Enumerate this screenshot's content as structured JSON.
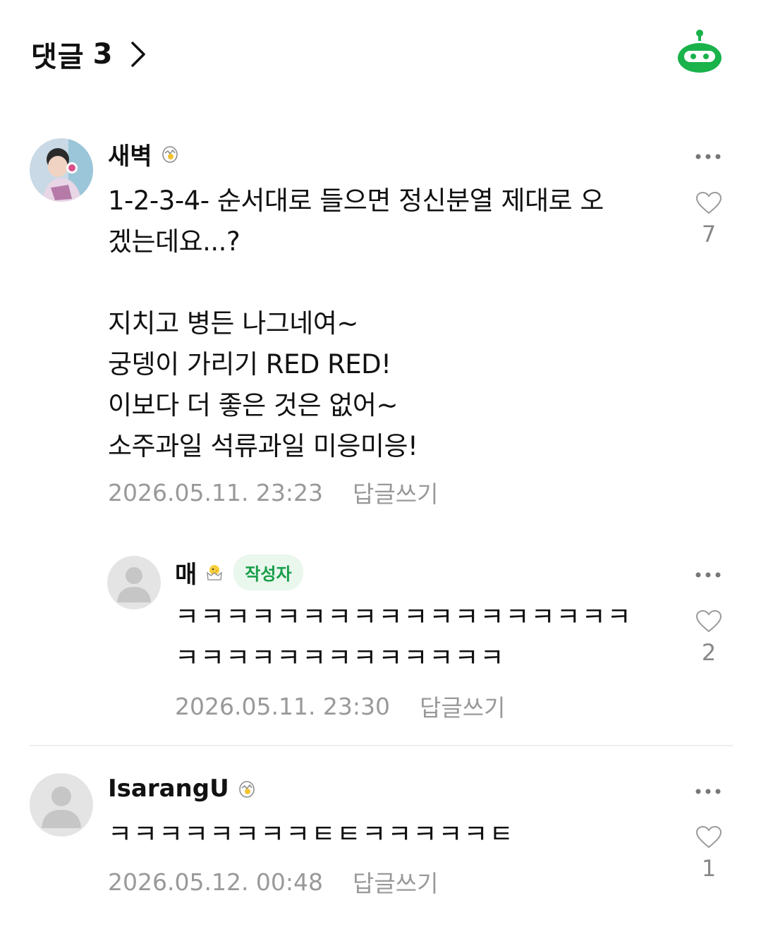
{
  "header": {
    "title": "댓글",
    "count": "3"
  },
  "colors": {
    "brand_green": "#19b24b",
    "meta_gray": "#999999",
    "badge_bg": "#e9f7ed",
    "badge_text": "#1a9e4a"
  },
  "comments": [
    {
      "author": "새벽",
      "avatar": "profile-photo",
      "level_icon": "egg-hatching-icon",
      "body": "1-2-3-4- 순서대로 들으면 정신분열 제대로 오\n겠는데요...?\n\n지치고 병든 나그네여~\n궁뎅이 가리기 RED RED!\n이보다 더 좋은 것은 없어~\n소주과일 석류과일 미응미응!",
      "date": "2026.05.11. 23:23",
      "reply_label": "답글쓰기",
      "likes": "7",
      "replies": [
        {
          "author": "매",
          "avatar": "default-avatar",
          "level_icon": "chick-icon",
          "badge": "작성자",
          "body": "ㅋㅋㅋㅋㅋㅋㅋㅋㅋㅋㅋㅋㅋㅋㅋㅋㅋㅋ\nㅋㅋㅋㅋㅋㅋㅋㅋㅋㅋㅋㅋㅋ",
          "date": "2026.05.11. 23:30",
          "reply_label": "답글쓰기",
          "likes": "2"
        }
      ]
    },
    {
      "author": "IsarangU",
      "avatar": "default-avatar",
      "level_icon": "egg-hatching-icon",
      "body": "ㅋㅋㅋㅋㅋㅋㅋㅋㅌㅌㅋㅋㅋㅋㅋㅌ",
      "date": "2026.05.12. 00:48",
      "reply_label": "답글쓰기",
      "likes": "1"
    }
  ]
}
